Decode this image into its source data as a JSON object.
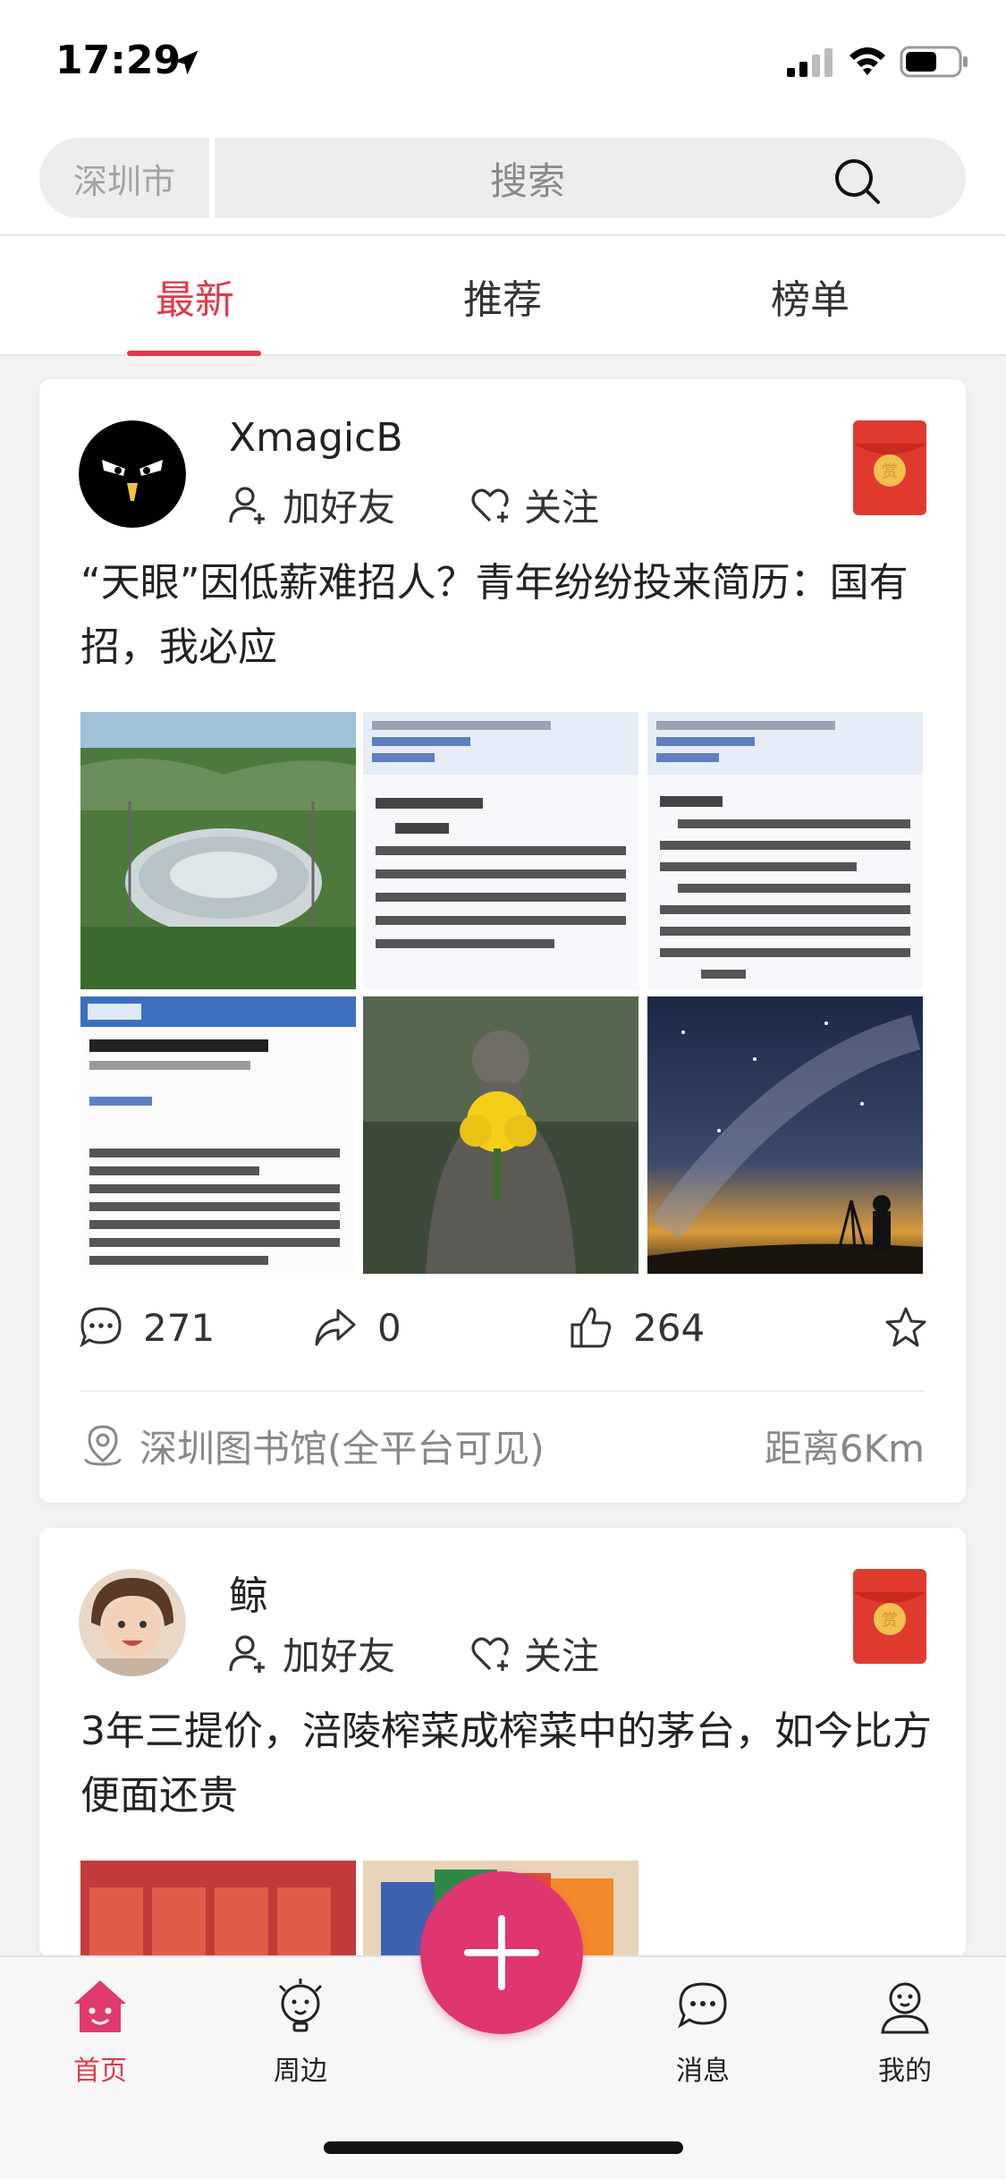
{
  "status_bar": {
    "time": "17:29"
  },
  "search": {
    "city": "深圳市",
    "placeholder": "搜索"
  },
  "tabs": [
    {
      "label": "最新",
      "active": true
    },
    {
      "label": "推荐",
      "active": false
    },
    {
      "label": "榜单",
      "active": false
    }
  ],
  "posts": [
    {
      "username": "XmagicB",
      "add_friend": "加好友",
      "follow": "关注",
      "title": "“天眼”因低薪难招人？青年纷纷投来简历：国有招，我必应",
      "images": [
        "telescope-dish-photo",
        "email-screenshot-1",
        "email-screenshot-2",
        "email-screenshot-3",
        "bronze-statue-with-flowers",
        "night-sky-milky-way"
      ],
      "stats": {
        "comments": "271",
        "shares": "0",
        "likes": "264"
      },
      "location": "深圳图书馆(全平台可见)",
      "distance": "距离6Km"
    },
    {
      "username": "鲸",
      "add_friend": "加好友",
      "follow": "关注",
      "title": "3年三提价，涪陵榨菜成榨菜中的茅台，如今比方便面还贵",
      "images": [
        "zhacai-packages-red",
        "zhacai-packages-colorful"
      ]
    }
  ],
  "tabbar": [
    {
      "label": "首页",
      "icon": "home-icon",
      "active": true
    },
    {
      "label": "周边",
      "icon": "nearby-icon",
      "active": false
    },
    {
      "label": "消息",
      "icon": "message-icon",
      "active": false
    },
    {
      "label": "我的",
      "icon": "profile-icon",
      "active": false
    }
  ],
  "colors": {
    "accent": "#e03a4c",
    "fab": "#df3571",
    "redpacket": "#e03a2f"
  }
}
